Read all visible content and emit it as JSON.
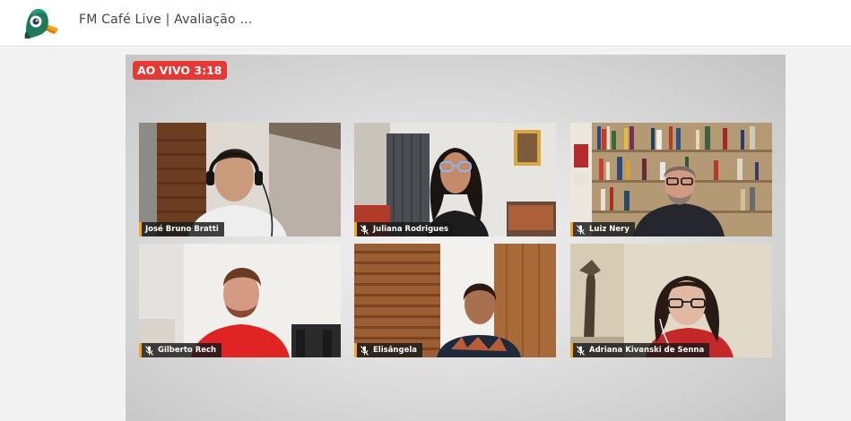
{
  "header": {
    "title": "FM Café Live | Avaliação …",
    "logo_icon": "duck-logo-icon"
  },
  "live": {
    "badge": "AO VIVO 3:18",
    "color": "#e53935"
  },
  "participants": [
    {
      "name": "José Bruno Bratti",
      "muted": false
    },
    {
      "name": "Juliana Rodrigues",
      "muted": true
    },
    {
      "name": "Luiz Nery",
      "muted": true
    },
    {
      "name": "Gilberto Rech",
      "muted": true
    },
    {
      "name": "Elisângela",
      "muted": true
    },
    {
      "name": "Adriana Kivanski de Senna",
      "muted": true
    }
  ],
  "colors": {
    "name_accent": "#f5a623",
    "stage_background": "#d6d6d6"
  }
}
